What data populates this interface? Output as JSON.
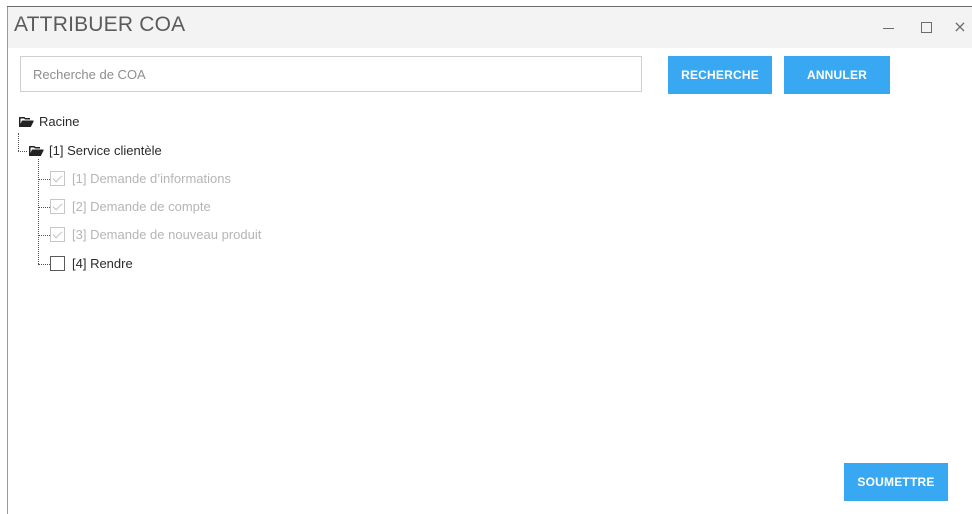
{
  "window": {
    "title": "ATTRIBUER COA"
  },
  "search": {
    "placeholder": "Recherche de COA",
    "value": ""
  },
  "buttons": {
    "search_label": "RECHERCHE",
    "cancel_label": "ANNULER",
    "submit_label": "SOUMETTRE"
  },
  "tree": {
    "root": {
      "label": "Racine",
      "icon": "folder-open-icon"
    },
    "group": {
      "label": "[1] Service clientèle",
      "icon": "folder-open-icon"
    },
    "items": [
      {
        "label": "[1] Demande d’informations",
        "checked": true,
        "disabled": true
      },
      {
        "label": "[2] Demande de compte",
        "checked": true,
        "disabled": true
      },
      {
        "label": "[3] Demande de nouveau produit",
        "checked": true,
        "disabled": true
      },
      {
        "label": "[4] Rendre",
        "checked": false,
        "disabled": false
      }
    ]
  },
  "colors": {
    "accent": "#38a8f3",
    "titlebar": "#f3f3f3",
    "disabled_text": "#b5b5b5"
  }
}
